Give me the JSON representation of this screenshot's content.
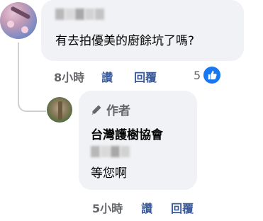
{
  "comment": {
    "text": "有去拍優美的廚餘坑了嗎?",
    "time": "8小時",
    "like_label": "讚",
    "reply_label": "回覆",
    "reaction_count": "5",
    "reaction_icon": "like-thumb-icon"
  },
  "reply": {
    "author_badge": "作者",
    "page_name": "台灣護樹協會",
    "text": "等您啊",
    "time": "5小時",
    "like_label": "讚",
    "reply_label": "回覆"
  },
  "colors": {
    "bubble_bg": "#f0f2f5",
    "link": "#385898",
    "meta": "#65676b",
    "like_blue": "#1877f2"
  }
}
